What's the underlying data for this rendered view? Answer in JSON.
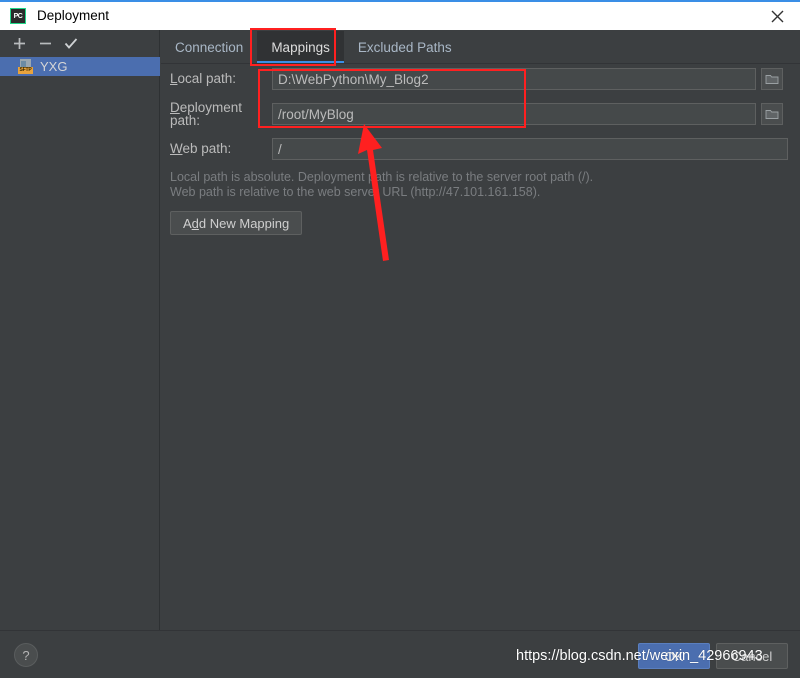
{
  "window": {
    "title": "Deployment",
    "app_icon": "pycharm-icon",
    "app_icon_text": "PC",
    "close_icon": "close-icon"
  },
  "sidebar": {
    "toolbar": [
      {
        "name": "add-server-button",
        "icon": "plus-icon",
        "label": "+"
      },
      {
        "name": "remove-server-button",
        "icon": "minus-icon",
        "label": "−"
      },
      {
        "name": "set-default-server-button",
        "icon": "check-icon",
        "label": "✓"
      }
    ],
    "items": [
      {
        "label": "YXG",
        "icon": "sftp-server-icon",
        "icon_tag": "SFTP",
        "selected": true
      }
    ]
  },
  "tabs": [
    {
      "label": "Connection",
      "active": false
    },
    {
      "label": "Mappings",
      "active": true
    },
    {
      "label": "Excluded Paths",
      "active": false
    }
  ],
  "form": {
    "local_path": {
      "label_prefix": "",
      "label_mnemonic": "L",
      "label_suffix": "ocal path:",
      "value": "D:\\WebPython\\My_Blog2",
      "browse_icon": "folder-icon"
    },
    "deployment_path": {
      "label_prefix": "",
      "label_mnemonic": "D",
      "label_suffix": "eployment path:",
      "value": "/root/MyBlog",
      "browse_icon": "folder-icon"
    },
    "web_path": {
      "label_prefix": "",
      "label_mnemonic": "W",
      "label_suffix": "eb path:",
      "value": "/"
    },
    "hint_line1": "Local path is absolute. Deployment path is relative to the server root path (/).",
    "hint_line2": "Web path is relative to the web server URL (http://47.101.161.158).",
    "add_mapping_button": {
      "prefix": "A",
      "mnemonic": "d",
      "suffix": "d New Mapping"
    }
  },
  "footer": {
    "help_label": "?",
    "ok_label": "OK",
    "cancel_label": "Cancel"
  },
  "annotations": {
    "watermark_text": "https://blog.csdn.net/weixin_42966943",
    "highlight_color": "#ff2020",
    "accent_color": "#3a8ee6",
    "selection_color": "#4b6eaf"
  }
}
